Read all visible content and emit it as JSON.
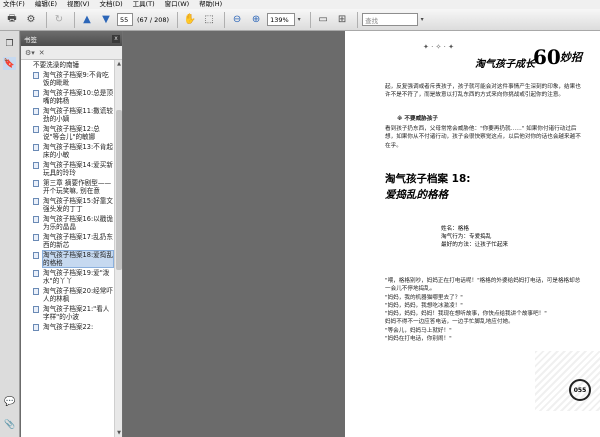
{
  "menu": [
    "文件(F)",
    "编辑(E)",
    "视图(V)",
    "文档(D)",
    "工具(T)",
    "窗口(W)",
    "帮助(H)"
  ],
  "toolbar": {
    "page_current": "55",
    "page_total": "(67 / 208)",
    "zoom": "139%",
    "search_placeholder": "查找"
  },
  "bookmarks_panel": {
    "title": "书签",
    "close": "x",
    "items": [
      {
        "text": "不要洗澡的南锤",
        "icon": false
      },
      {
        "text": "淘气孩子档案9:不肯吃饭的毗毗",
        "icon": true
      },
      {
        "text": "淘气孩子档案10:总是顶嘴的韩杨",
        "icon": true
      },
      {
        "text": "淘气孩子档案11:撒谎较劲的小嫡",
        "icon": true
      },
      {
        "text": "淘气孩子档案12:总说\"等会儿\"的敏娜",
        "icon": true
      },
      {
        "text": "淘气孩子档案13:不肯起床的小敏",
        "icon": true
      },
      {
        "text": "淘气孩子档案14:爱买新玩具的玲玲",
        "icon": true
      },
      {
        "text": "第三章 摘要作剧型——开个玩笑嘛, 别在意",
        "icon": true
      },
      {
        "text": "淘气孩子档案15:好靠文强头发的丁丁",
        "icon": true
      },
      {
        "text": "淘气孩子档案16:以戳诡为乐的晶晶",
        "icon": true
      },
      {
        "text": "淘气孩子档案17:乱扔东西的新芯",
        "icon": true
      },
      {
        "text": "淘气孩子档案18:爱捣乱的格格",
        "icon": true,
        "selected": true
      },
      {
        "text": "淘气孩子档案19:爱\"泼水\"的丫丫",
        "icon": true
      },
      {
        "text": "淘气孩子档案20:经常吓人的林枫",
        "icon": true
      },
      {
        "text": "淘气孩子档案21:\"看人字样\"的小波",
        "icon": true
      },
      {
        "text": "淘气孩子档案22:",
        "icon": true
      }
    ]
  },
  "page": {
    "header_prefix": "淘气孩子成长",
    "header_number": "60",
    "header_suffix": "妙招",
    "para1": "起，反复强调或者斥责孩子，孩子就可能会对这件事情产生深刻的印象，结果也许不是不符了，而是故意以打乱东西的方式来向你挑战或引起你的注意。",
    "sub_head": "※ 不要威胁孩子",
    "para2": "看到孩子扔东西，父母常常会威胁他：\"你要再扔就……\" 如果你付诸行动过后想，如果你从不付诸行动，孩子会很快察觉这点，以后他对你的话也会越来越不在乎。",
    "section_title": "淘气孩子档案 18:",
    "section_subtitle": "爱捣乱的格格",
    "info_name": "姓名：格格",
    "info_act": "淘气行为：专爱捣乱",
    "info_fav": "最好的方法：让孩子忙起来",
    "story": "\"喂，格格别吵，妈妈正在打电话呢！\"格格的外婆给妈妈打电话，可是格格却总一会儿不停地捣乱。\n\"妈妈，我的机器猫哪里去了？\"\n\"妈妈，妈妈，我想吃冰激凌！\"\n\"妈妈，妈妈，妈妈！我现在想听故事，你快点给我讲个故事吧！\"\n妈妈不得不一边应答电话，一边手忙脚乱地应付她。\n\"等会儿，妈妈马上就好！\"\n\"妈妈在打电话，你别闹！\"",
    "page_number": "055"
  }
}
